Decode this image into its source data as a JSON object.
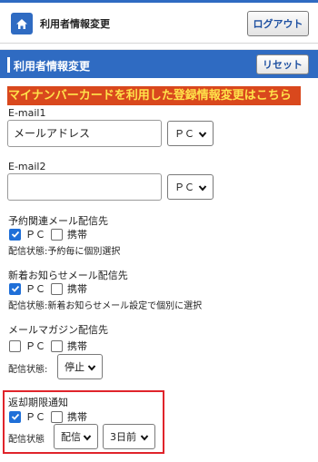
{
  "header": {
    "title": "利用者情報変更",
    "logout_label": "ログアウト",
    "home_icon": "home-icon"
  },
  "section": {
    "title": "利用者情報変更",
    "reset_label": "リセット"
  },
  "mynumber_link": "マイナンバーカードを利用した登録情報変更はこちら",
  "email1": {
    "label": "E-mail1",
    "value": "メールアドレス",
    "type_selected": "ＰＣ"
  },
  "email2": {
    "label": "E-mail2",
    "value": "",
    "type_selected": "ＰＣ"
  },
  "reservation_mail": {
    "label": "予約関連メール配信先",
    "pc_label": "ＰＣ",
    "pc_checked": true,
    "mobile_label": "携帯",
    "mobile_checked": false,
    "status": "配信状態:予約毎に個別選択"
  },
  "new_arrival_mail": {
    "label": "新着お知らせメール配信先",
    "pc_label": "ＰＣ",
    "pc_checked": true,
    "mobile_label": "携帯",
    "mobile_checked": false,
    "status": "配信状態:新着お知らせメール設定で個別に選択"
  },
  "magazine_mail": {
    "label": "メールマガジン配信先",
    "pc_label": "ＰＣ",
    "pc_checked": false,
    "mobile_label": "携帯",
    "mobile_checked": false,
    "status_label": "配信状態:",
    "status_selected": "停止"
  },
  "return_notice": {
    "label": "返却期限通知",
    "pc_label": "ＰＣ",
    "pc_checked": true,
    "mobile_label": "携帯",
    "mobile_checked": false,
    "status_label": "配信状態",
    "delivery_selected": "配信",
    "days_selected": "3日前"
  },
  "colors": {
    "brand_blue": "#2f6bc2",
    "link_bg": "#d9481d",
    "link_text": "#ffe24a",
    "checkbox_blue": "#1f6fd8",
    "highlight_red": "#e0242b"
  }
}
